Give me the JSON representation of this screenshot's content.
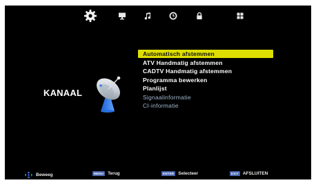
{
  "tabs": [
    {
      "icon": "gear-icon",
      "active": true
    },
    {
      "icon": "monitor-icon"
    },
    {
      "icon": "music-note-icon"
    },
    {
      "icon": "clock-icon"
    },
    {
      "icon": "lock-icon"
    },
    {
      "icon": "grid-icon"
    }
  ],
  "section": {
    "label": "KANAAL",
    "icon": "satellite-dish-icon"
  },
  "menu": {
    "items": [
      {
        "label": "Automatisch afstemmen",
        "state": "selected"
      },
      {
        "label": "ATV Handmatig afstemmen",
        "state": "normal"
      },
      {
        "label": "CADTV Handmatig afstemmen",
        "state": "normal"
      },
      {
        "label": "Programma bewerken",
        "state": "normal"
      },
      {
        "label": "Planlijst",
        "state": "normal"
      },
      {
        "label": "Signaalinformatie",
        "state": "disabled"
      },
      {
        "label": "CI-informatie",
        "state": "disabled"
      }
    ]
  },
  "footer": {
    "move": {
      "icon": "dpad-icon",
      "label": "Beweeg"
    },
    "back": {
      "key": "MENU",
      "label": "Terug"
    },
    "select": {
      "key": "ENTER",
      "label": "Selecteer"
    },
    "exit": {
      "key": "EXIT",
      "label": "AFSLUITEN"
    }
  },
  "colors": {
    "background": "#000000",
    "highlight": "#ddde00",
    "disabled_text": "#9fb6cc",
    "key_badge": "#4a66b0"
  }
}
